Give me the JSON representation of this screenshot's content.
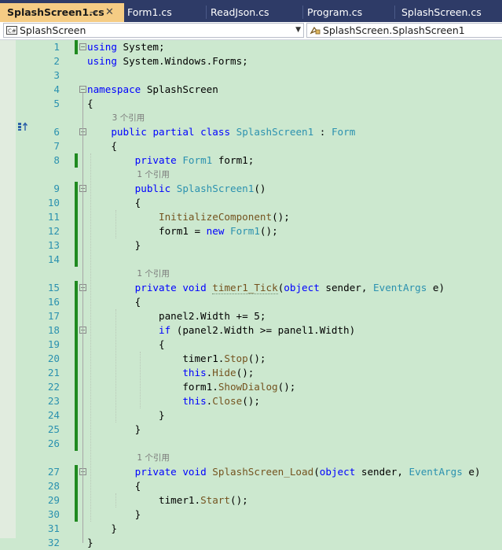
{
  "tabs": [
    {
      "label": "SplashScreen1.cs",
      "active": true,
      "pin": "⊸",
      "close": "✕"
    },
    {
      "label": "Form1.cs",
      "active": false
    },
    {
      "label": "ReadJson.cs",
      "active": false
    },
    {
      "label": "Program.cs",
      "active": false
    },
    {
      "label": "SplashScreen.cs",
      "active": false
    }
  ],
  "navbar": {
    "project": "SplashScreen",
    "type": "SplashScreen.SplashScreen1",
    "project_icon": "csharp-project-icon",
    "type_icon": "class-member-icon",
    "arrow": "▼"
  },
  "colors": {
    "editor_bg": "#cce8cf",
    "tab_bar_bg": "#2e3b67",
    "active_tab_bg": "#f5cc84",
    "keyword": "#0000ff",
    "type": "#2b91af",
    "method": "#74531f",
    "line_number": "#2b91af",
    "change_bar": "#1f8a20",
    "lens_text": "#7a7a7a"
  },
  "code_lens": [
    {
      "text": "3 个引用",
      "before_line": 6
    },
    {
      "text": "1 个引用",
      "before_line": 9
    },
    {
      "text": "1 个引用",
      "before_line": 15
    },
    {
      "text": "1 个引用",
      "before_line": 27
    }
  ],
  "lines": [
    {
      "n": "1",
      "tokens": [
        [
          "k",
          "using"
        ],
        [
          "p",
          " System;"
        ]
      ]
    },
    {
      "n": "2",
      "tokens": [
        [
          "k",
          "using"
        ],
        [
          "p",
          " System.Windows.Forms;"
        ]
      ]
    },
    {
      "n": "3",
      "tokens": []
    },
    {
      "n": "4",
      "tokens": [
        [
          "k",
          "namespace"
        ],
        [
          "p",
          " SplashScreen"
        ]
      ]
    },
    {
      "n": "5",
      "tokens": [
        [
          "p",
          "{"
        ]
      ]
    },
    {
      "n": "6",
      "tokens": [
        [
          "p",
          "    "
        ],
        [
          "k",
          "public"
        ],
        [
          "p",
          " "
        ],
        [
          "k",
          "partial"
        ],
        [
          "p",
          " "
        ],
        [
          "k",
          "class"
        ],
        [
          "p",
          " "
        ],
        [
          "t",
          "SplashScreen1"
        ],
        [
          "p",
          " : "
        ],
        [
          "t",
          "Form"
        ]
      ]
    },
    {
      "n": "7",
      "tokens": [
        [
          "p",
          "    {"
        ]
      ]
    },
    {
      "n": "8",
      "tokens": [
        [
          "p",
          "        "
        ],
        [
          "k",
          "private"
        ],
        [
          "p",
          " "
        ],
        [
          "t",
          "Form1"
        ],
        [
          "p",
          " form1;"
        ]
      ]
    },
    {
      "n": "9",
      "tokens": [
        [
          "p",
          "        "
        ],
        [
          "k",
          "public"
        ],
        [
          "p",
          " "
        ],
        [
          "t",
          "SplashScreen1"
        ],
        [
          "p",
          "()"
        ]
      ]
    },
    {
      "n": "10",
      "tokens": [
        [
          "p",
          "        {"
        ]
      ]
    },
    {
      "n": "11",
      "tokens": [
        [
          "p",
          "            "
        ],
        [
          "m",
          "InitializeComponent"
        ],
        [
          "p",
          "();"
        ]
      ]
    },
    {
      "n": "12",
      "tokens": [
        [
          "p",
          "            form1 = "
        ],
        [
          "k",
          "new"
        ],
        [
          "p",
          " "
        ],
        [
          "t",
          "Form1"
        ],
        [
          "p",
          "();"
        ]
      ]
    },
    {
      "n": "13",
      "tokens": [
        [
          "p",
          "        }"
        ]
      ]
    },
    {
      "n": "14",
      "tokens": []
    },
    {
      "n": "15",
      "tokens": [
        [
          "p",
          "        "
        ],
        [
          "k",
          "private"
        ],
        [
          "p",
          " "
        ],
        [
          "k",
          "void"
        ],
        [
          "p",
          " "
        ],
        [
          "m",
          "timer1_Tick"
        ],
        [
          "p",
          "("
        ],
        [
          "k",
          "object"
        ],
        [
          "p",
          " sender, "
        ],
        [
          "t",
          "EventArgs"
        ],
        [
          "p",
          " e)"
        ]
      ]
    },
    {
      "n": "16",
      "tokens": [
        [
          "p",
          "        {"
        ]
      ]
    },
    {
      "n": "17",
      "tokens": [
        [
          "p",
          "            panel2.Width += 5;"
        ]
      ]
    },
    {
      "n": "18",
      "tokens": [
        [
          "p",
          "            "
        ],
        [
          "k",
          "if"
        ],
        [
          "p",
          " (panel2.Width >= panel1.Width)"
        ]
      ]
    },
    {
      "n": "19",
      "tokens": [
        [
          "p",
          "            {"
        ]
      ]
    },
    {
      "n": "20",
      "tokens": [
        [
          "p",
          "                timer1."
        ],
        [
          "m",
          "Stop"
        ],
        [
          "p",
          "();"
        ]
      ]
    },
    {
      "n": "21",
      "tokens": [
        [
          "p",
          "                "
        ],
        [
          "k",
          "this"
        ],
        [
          "p",
          "."
        ],
        [
          "m",
          "Hide"
        ],
        [
          "p",
          "();"
        ]
      ]
    },
    {
      "n": "22",
      "tokens": [
        [
          "p",
          "                form1."
        ],
        [
          "m",
          "ShowDialog"
        ],
        [
          "p",
          "();"
        ]
      ]
    },
    {
      "n": "23",
      "tokens": [
        [
          "p",
          "                "
        ],
        [
          "k",
          "this"
        ],
        [
          "p",
          "."
        ],
        [
          "m",
          "Close"
        ],
        [
          "p",
          "();"
        ]
      ]
    },
    {
      "n": "24",
      "tokens": [
        [
          "p",
          "            }"
        ]
      ]
    },
    {
      "n": "25",
      "tokens": [
        [
          "p",
          "        }"
        ]
      ]
    },
    {
      "n": "26",
      "tokens": []
    },
    {
      "n": "27",
      "tokens": [
        [
          "p",
          "        "
        ],
        [
          "k",
          "private"
        ],
        [
          "p",
          " "
        ],
        [
          "k",
          "void"
        ],
        [
          "p",
          " "
        ],
        [
          "m",
          "SplashScreen_Load"
        ],
        [
          "p",
          "("
        ],
        [
          "k",
          "object"
        ],
        [
          "p",
          " sender, "
        ],
        [
          "t",
          "EventArgs"
        ],
        [
          "p",
          " e)"
        ]
      ]
    },
    {
      "n": "28",
      "tokens": [
        [
          "p",
          "        {"
        ]
      ]
    },
    {
      "n": "29",
      "tokens": [
        [
          "p",
          "            timer1."
        ],
        [
          "m",
          "Start"
        ],
        [
          "p",
          "();"
        ]
      ]
    },
    {
      "n": "30",
      "tokens": [
        [
          "p",
          "        }"
        ]
      ]
    },
    {
      "n": "31",
      "tokens": [
        [
          "p",
          "    }"
        ]
      ]
    },
    {
      "n": "32",
      "tokens": [
        [
          "p",
          "}"
        ]
      ]
    }
  ]
}
